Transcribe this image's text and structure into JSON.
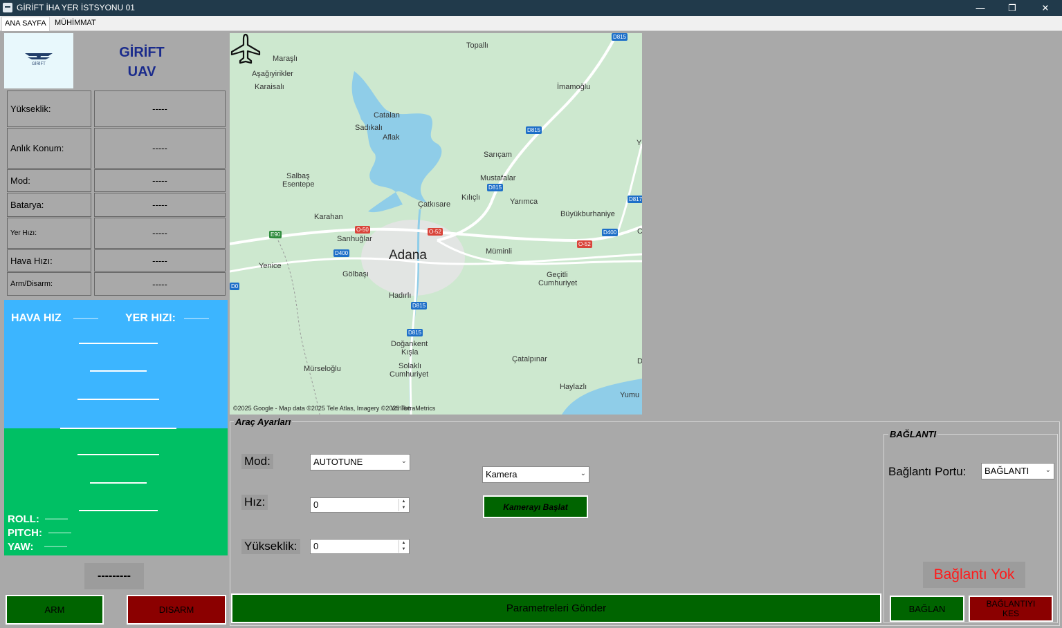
{
  "window": {
    "title": "GİRİFT İHA YER İSTSYONU 01",
    "minimize": "—",
    "maximize": "❐",
    "close": "✕"
  },
  "tabs": [
    {
      "label": "ANA SAYFA"
    },
    {
      "label": "MÜHİMMAT"
    }
  ],
  "brand": {
    "line1": "GİRİFT",
    "line2": "UAV",
    "logo_text": "GİRİFT"
  },
  "telemetry": [
    {
      "label": "Yükseklik:",
      "value": "-----"
    },
    {
      "label": "Anlık Konum:",
      "value": "-----"
    },
    {
      "label": "Mod:",
      "value": "-----"
    },
    {
      "label": "Batarya:",
      "value": "-----"
    },
    {
      "label": "Yer Hızı:",
      "value": "-----"
    },
    {
      "label": "Hava Hızı:",
      "value": "-----"
    },
    {
      "label": "Arm/Disarm:",
      "value": "-----"
    }
  ],
  "horizon": {
    "air_speed_label": "HAVA HIZ",
    "air_speed_value": "———",
    "ground_speed_label": "YER HIZI:",
    "ground_speed_value": "———",
    "roll_label": "ROLL:",
    "roll_value": "———",
    "pitch_label": "PITCH:",
    "pitch_value": "———",
    "yaw_label": "YAW:",
    "yaw_value": "———",
    "sky_color": "#3cb5ff",
    "ground_color": "#00c064"
  },
  "status_text": "---------",
  "arm_button": "ARM",
  "disarm_button": "DISARM",
  "map": {
    "city": "Adana",
    "labels": [
      "Maraşlı",
      "Aşağıyirikler",
      "Karaisalı",
      "Topallı",
      "İmamoğlu",
      "Catalan",
      "Sadıkalı",
      "Aflak",
      "Sarıçam",
      "Mustafalar",
      "Salbaş",
      "Esentepe",
      "Kılıçlı",
      "Yarımca",
      "Çatkısare",
      "Büyükburhaniye",
      "Karahan",
      "Sarıhuğlar",
      "Müminli",
      "Yenice",
      "Gölbaşı",
      "Geçitli",
      "Cumhuriyet",
      "Hadırlı",
      "Doğankent",
      "Kışla",
      "Solaklı",
      "Cumhuriyet",
      "Mürseloğlu",
      "Çatalpınar",
      "Haylazlı",
      "Yumu",
      "Y",
      "C",
      "D"
    ],
    "roads": [
      "D815",
      "D815",
      "D815",
      "D815",
      "D815",
      "D400",
      "D400",
      "O-50",
      "O-52",
      "O-52",
      "E90",
      "D817",
      "D0"
    ],
    "credit": "©2025 Google - Map data ©2025 Tele Atlas, Imagery ©2025 TerraMetrics",
    "credit_overlay": "Yenice"
  },
  "vehicle_settings": {
    "title": "Araç Ayarları",
    "mode_label": "Mod:",
    "mode_value": "AUTOTUNE",
    "speed_label": "Hız:",
    "speed_value": "0",
    "altitude_label": "Yükseklik:",
    "altitude_value": "0",
    "camera_value": "Kamera",
    "camera_button": "Kamerayı Başlat",
    "send_button": "Parametreleri Gönder"
  },
  "connection": {
    "title": "BAĞLANTI",
    "port_label": "Bağlantı Portu:",
    "port_value": "BAĞLANTI",
    "status": "Bağlantı Yok",
    "status_color": "#ff1a1a",
    "connect_button": "BAĞLAN",
    "disconnect_button_line1": "BAĞLANTIYI",
    "disconnect_button_line2": "KES"
  }
}
